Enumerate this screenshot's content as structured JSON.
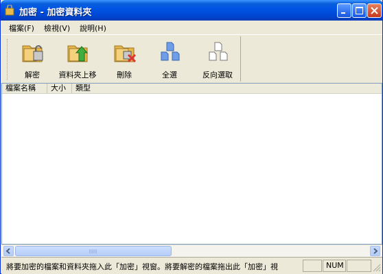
{
  "window": {
    "title": "加密 - 加密資料夾"
  },
  "menu": [
    {
      "label": "檔案(F)"
    },
    {
      "label": "檢視(V)"
    },
    {
      "label": "說明(H)"
    }
  ],
  "toolbar": [
    {
      "label": "解密",
      "icon": "decrypt-folder-icon"
    },
    {
      "label": "資料夾上移",
      "icon": "folder-up-icon"
    },
    {
      "label": "刪除",
      "icon": "delete-icon"
    },
    {
      "label": "全選",
      "icon": "select-all-icon"
    },
    {
      "label": "反向選取",
      "icon": "invert-selection-icon"
    }
  ],
  "columns": [
    {
      "label": "檔案名稱"
    },
    {
      "label": "大小"
    },
    {
      "label": "類型"
    }
  ],
  "status": {
    "message": "將要加密的檔案和資料夾拖入此「加密」視窗。將要解密的檔案拖出此「加密」視",
    "num": "NUM"
  },
  "colors": {
    "titlebar": "#0055e5",
    "chrome": "#ece9d8",
    "border": "#0831d9"
  }
}
